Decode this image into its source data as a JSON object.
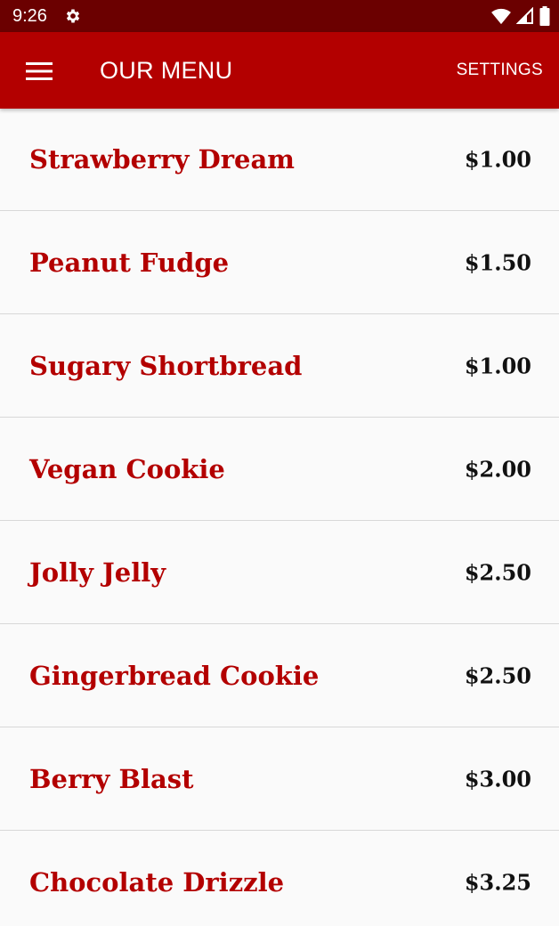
{
  "status_bar": {
    "time": "9:26",
    "icons": [
      "gear-icon",
      "wifi-icon",
      "cell-signal-icon",
      "battery-icon"
    ]
  },
  "app_bar": {
    "title": "OUR MENU",
    "settings_label": "SETTINGS",
    "menu_icon": "hamburger-menu-icon"
  },
  "colors": {
    "status_bar": "#6b0000",
    "app_bar": "#b30000",
    "item_name": "#b30000",
    "price": "#111111",
    "background": "#fafafa",
    "divider": "#d8d8d8"
  },
  "menu": {
    "items": [
      {
        "name": "Strawberry Dream",
        "price": "$1.00"
      },
      {
        "name": "Peanut Fudge",
        "price": "$1.50"
      },
      {
        "name": "Sugary Shortbread",
        "price": "$1.00"
      },
      {
        "name": "Vegan Cookie",
        "price": "$2.00"
      },
      {
        "name": "Jolly Jelly",
        "price": "$2.50"
      },
      {
        "name": "Gingerbread Cookie",
        "price": "$2.50"
      },
      {
        "name": "Berry Blast",
        "price": "$3.00"
      },
      {
        "name": "Chocolate Drizzle",
        "price": "$3.25"
      }
    ]
  }
}
